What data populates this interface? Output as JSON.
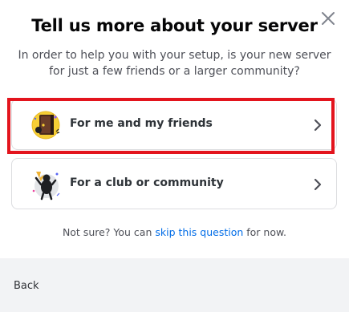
{
  "modal": {
    "title": "Tell us more about your server",
    "subtitle": "In order to help you with your setup, is your new server for just a few friends or a larger community?"
  },
  "options": [
    {
      "label": "For me and my friends",
      "icon": "friends-illustration-icon"
    },
    {
      "label": "For a club or community",
      "icon": "community-illustration-icon"
    }
  ],
  "skip": {
    "prefix": "Not sure? You can ",
    "link": "skip this question",
    "suffix": " for now."
  },
  "footer": {
    "back_label": "Back"
  },
  "colors": {
    "highlight": "#e3141d",
    "link": "#006ce7",
    "footer_bg": "#f2f3f5"
  }
}
